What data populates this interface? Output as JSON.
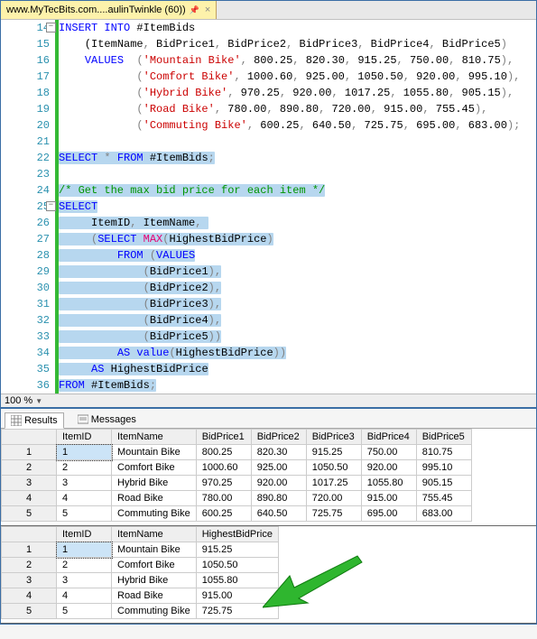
{
  "tab": {
    "label": "www.MyTecBits.com....aulinTwinkle (60))",
    "close": "×"
  },
  "editor": {
    "lines": [
      {
        "n": "14",
        "marker": true,
        "toggle": true,
        "parts": [
          {
            "c": "kw",
            "t": "INSERT INTO"
          },
          {
            "t": " #ItemBids"
          }
        ]
      },
      {
        "n": "15",
        "marker": true,
        "parts": [
          {
            "t": "    ("
          },
          {
            "t": "ItemName"
          },
          {
            "c": "gray",
            "t": ","
          },
          {
            "t": " BidPrice1"
          },
          {
            "c": "gray",
            "t": ","
          },
          {
            "t": " BidPrice2"
          },
          {
            "c": "gray",
            "t": ","
          },
          {
            "t": " BidPrice3"
          },
          {
            "c": "gray",
            "t": ","
          },
          {
            "t": " BidPrice4"
          },
          {
            "c": "gray",
            "t": ","
          },
          {
            "t": " BidPrice5"
          },
          {
            "c": "gray",
            "t": ")"
          }
        ]
      },
      {
        "n": "16",
        "marker": true,
        "parts": [
          {
            "t": "    "
          },
          {
            "c": "kw",
            "t": "VALUES"
          },
          {
            "t": "  "
          },
          {
            "c": "gray",
            "t": "("
          },
          {
            "c": "str",
            "t": "'Mountain Bike'"
          },
          {
            "c": "gray",
            "t": ","
          },
          {
            "t": " 800.25"
          },
          {
            "c": "gray",
            "t": ","
          },
          {
            "t": " 820.30"
          },
          {
            "c": "gray",
            "t": ","
          },
          {
            "t": " 915.25"
          },
          {
            "c": "gray",
            "t": ","
          },
          {
            "t": " 750.00"
          },
          {
            "c": "gray",
            "t": ","
          },
          {
            "t": " 810.75"
          },
          {
            "c": "gray",
            "t": "),"
          }
        ]
      },
      {
        "n": "17",
        "marker": true,
        "parts": [
          {
            "t": "            "
          },
          {
            "c": "gray",
            "t": "("
          },
          {
            "c": "str",
            "t": "'Comfort Bike'"
          },
          {
            "c": "gray",
            "t": ","
          },
          {
            "t": " 1000.60"
          },
          {
            "c": "gray",
            "t": ","
          },
          {
            "t": " 925.00"
          },
          {
            "c": "gray",
            "t": ","
          },
          {
            "t": " 1050.50"
          },
          {
            "c": "gray",
            "t": ","
          },
          {
            "t": " 920.00"
          },
          {
            "c": "gray",
            "t": ","
          },
          {
            "t": " 995.10"
          },
          {
            "c": "gray",
            "t": "),"
          }
        ]
      },
      {
        "n": "18",
        "marker": true,
        "parts": [
          {
            "t": "            "
          },
          {
            "c": "gray",
            "t": "("
          },
          {
            "c": "str",
            "t": "'Hybrid Bike'"
          },
          {
            "c": "gray",
            "t": ","
          },
          {
            "t": " 970.25"
          },
          {
            "c": "gray",
            "t": ","
          },
          {
            "t": " 920.00"
          },
          {
            "c": "gray",
            "t": ","
          },
          {
            "t": " 1017.25"
          },
          {
            "c": "gray",
            "t": ","
          },
          {
            "t": " 1055.80"
          },
          {
            "c": "gray",
            "t": ","
          },
          {
            "t": " 905.15"
          },
          {
            "c": "gray",
            "t": "),"
          }
        ]
      },
      {
        "n": "19",
        "marker": true,
        "parts": [
          {
            "t": "            "
          },
          {
            "c": "gray",
            "t": "("
          },
          {
            "c": "str",
            "t": "'Road Bike'"
          },
          {
            "c": "gray",
            "t": ","
          },
          {
            "t": " 780.00"
          },
          {
            "c": "gray",
            "t": ","
          },
          {
            "t": " 890.80"
          },
          {
            "c": "gray",
            "t": ","
          },
          {
            "t": " 720.00"
          },
          {
            "c": "gray",
            "t": ","
          },
          {
            "t": " 915.00"
          },
          {
            "c": "gray",
            "t": ","
          },
          {
            "t": " 755.45"
          },
          {
            "c": "gray",
            "t": "),"
          }
        ]
      },
      {
        "n": "20",
        "marker": true,
        "parts": [
          {
            "t": "            "
          },
          {
            "c": "gray",
            "t": "("
          },
          {
            "c": "str",
            "t": "'Commuting Bike'"
          },
          {
            "c": "gray",
            "t": ","
          },
          {
            "t": " 600.25"
          },
          {
            "c": "gray",
            "t": ","
          },
          {
            "t": " 640.50"
          },
          {
            "c": "gray",
            "t": ","
          },
          {
            "t": " 725.75"
          },
          {
            "c": "gray",
            "t": ","
          },
          {
            "t": " 695.00"
          },
          {
            "c": "gray",
            "t": ","
          },
          {
            "t": " 683.00"
          },
          {
            "c": "gray",
            "t": ");"
          }
        ]
      },
      {
        "n": "21",
        "marker": true,
        "parts": [
          {
            "t": ""
          }
        ]
      },
      {
        "n": "22",
        "marker": true,
        "hl": true,
        "parts": [
          {
            "c": "kw",
            "t": "SELECT"
          },
          {
            "t": " "
          },
          {
            "c": "gray",
            "t": "*"
          },
          {
            "t": " "
          },
          {
            "c": "kw",
            "t": "FROM"
          },
          {
            "t": " #ItemBids"
          },
          {
            "c": "gray",
            "t": ";"
          }
        ]
      },
      {
        "n": "23",
        "marker": true,
        "parts": [
          {
            "t": ""
          }
        ]
      },
      {
        "n": "24",
        "marker": true,
        "hl": true,
        "parts": [
          {
            "c": "cmt",
            "t": "/* Get the max bid price for each item */"
          }
        ]
      },
      {
        "n": "25",
        "marker": true,
        "toggle": true,
        "hl": true,
        "parts": [
          {
            "c": "kw",
            "t": "SELECT"
          }
        ]
      },
      {
        "n": "26",
        "marker": true,
        "hl": true,
        "parts": [
          {
            "t": "     ItemID"
          },
          {
            "c": "gray",
            "t": ","
          },
          {
            "t": " ItemName"
          },
          {
            "c": "gray",
            "t": ","
          },
          {
            "t": " "
          }
        ]
      },
      {
        "n": "27",
        "marker": true,
        "hl": true,
        "parts": [
          {
            "t": "     "
          },
          {
            "c": "gray",
            "t": "("
          },
          {
            "c": "kw",
            "t": "SELECT"
          },
          {
            "t": " "
          },
          {
            "c": "fn",
            "t": "MAX"
          },
          {
            "c": "gray",
            "t": "("
          },
          {
            "t": "HighestBidPrice"
          },
          {
            "c": "gray",
            "t": ")"
          }
        ]
      },
      {
        "n": "28",
        "marker": true,
        "hl": true,
        "parts": [
          {
            "t": "         "
          },
          {
            "c": "kw",
            "t": "FROM"
          },
          {
            "t": " "
          },
          {
            "c": "gray",
            "t": "("
          },
          {
            "c": "kw",
            "t": "VALUES"
          }
        ]
      },
      {
        "n": "29",
        "marker": true,
        "hl": true,
        "parts": [
          {
            "t": "             "
          },
          {
            "c": "gray",
            "t": "("
          },
          {
            "t": "BidPrice1"
          },
          {
            "c": "gray",
            "t": "),"
          }
        ]
      },
      {
        "n": "30",
        "marker": true,
        "hl": true,
        "parts": [
          {
            "t": "             "
          },
          {
            "c": "gray",
            "t": "("
          },
          {
            "t": "BidPrice2"
          },
          {
            "c": "gray",
            "t": "),"
          }
        ]
      },
      {
        "n": "31",
        "marker": true,
        "hl": true,
        "parts": [
          {
            "t": "             "
          },
          {
            "c": "gray",
            "t": "("
          },
          {
            "t": "BidPrice3"
          },
          {
            "c": "gray",
            "t": "),"
          }
        ]
      },
      {
        "n": "32",
        "marker": true,
        "hl": true,
        "parts": [
          {
            "t": "             "
          },
          {
            "c": "gray",
            "t": "("
          },
          {
            "t": "BidPrice4"
          },
          {
            "c": "gray",
            "t": "),"
          }
        ]
      },
      {
        "n": "33",
        "marker": true,
        "hl": true,
        "parts": [
          {
            "t": "             "
          },
          {
            "c": "gray",
            "t": "("
          },
          {
            "t": "BidPrice5"
          },
          {
            "c": "gray",
            "t": "))"
          }
        ]
      },
      {
        "n": "34",
        "marker": true,
        "hl": true,
        "parts": [
          {
            "t": "         "
          },
          {
            "c": "kw",
            "t": "AS"
          },
          {
            "t": " "
          },
          {
            "c": "kw",
            "t": "value"
          },
          {
            "c": "gray",
            "t": "("
          },
          {
            "t": "HighestBidPrice"
          },
          {
            "c": "gray",
            "t": "))"
          }
        ]
      },
      {
        "n": "35",
        "marker": true,
        "hl": true,
        "parts": [
          {
            "t": "     "
          },
          {
            "c": "kw",
            "t": "AS"
          },
          {
            "t": " HighestBidPrice"
          }
        ]
      },
      {
        "n": "36",
        "marker": true,
        "hl": true,
        "parts": [
          {
            "c": "kw",
            "t": "FROM"
          },
          {
            "t": " #ItemBids"
          },
          {
            "c": "gray",
            "t": ";"
          }
        ]
      }
    ]
  },
  "zoom": {
    "value": "100 %"
  },
  "results_tabs": {
    "results": "Results",
    "messages": "Messages"
  },
  "grid1": {
    "headers": [
      "",
      "ItemID",
      "ItemName",
      "BidPrice1",
      "BidPrice2",
      "BidPrice3",
      "BidPrice4",
      "BidPrice5"
    ],
    "rows": [
      [
        "1",
        "1",
        "Mountain Bike",
        "800.25",
        "820.30",
        "915.25",
        "750.00",
        "810.75"
      ],
      [
        "2",
        "2",
        "Comfort Bike",
        "1000.60",
        "925.00",
        "1050.50",
        "920.00",
        "995.10"
      ],
      [
        "3",
        "3",
        "Hybrid Bike",
        "970.25",
        "920.00",
        "1017.25",
        "1055.80",
        "905.15"
      ],
      [
        "4",
        "4",
        "Road Bike",
        "780.00",
        "890.80",
        "720.00",
        "915.00",
        "755.45"
      ],
      [
        "5",
        "5",
        "Commuting Bike",
        "600.25",
        "640.50",
        "725.75",
        "695.00",
        "683.00"
      ]
    ]
  },
  "grid2": {
    "headers": [
      "",
      "ItemID",
      "ItemName",
      "HighestBidPrice"
    ],
    "rows": [
      [
        "1",
        "1",
        "Mountain Bike",
        "915.25"
      ],
      [
        "2",
        "2",
        "Comfort Bike",
        "1050.50"
      ],
      [
        "3",
        "3",
        "Hybrid Bike",
        "1055.80"
      ],
      [
        "4",
        "4",
        "Road Bike",
        "915.00"
      ],
      [
        "5",
        "5",
        "Commuting Bike",
        "725.75"
      ]
    ]
  },
  "arrow": {
    "color": "#2fb62f"
  }
}
